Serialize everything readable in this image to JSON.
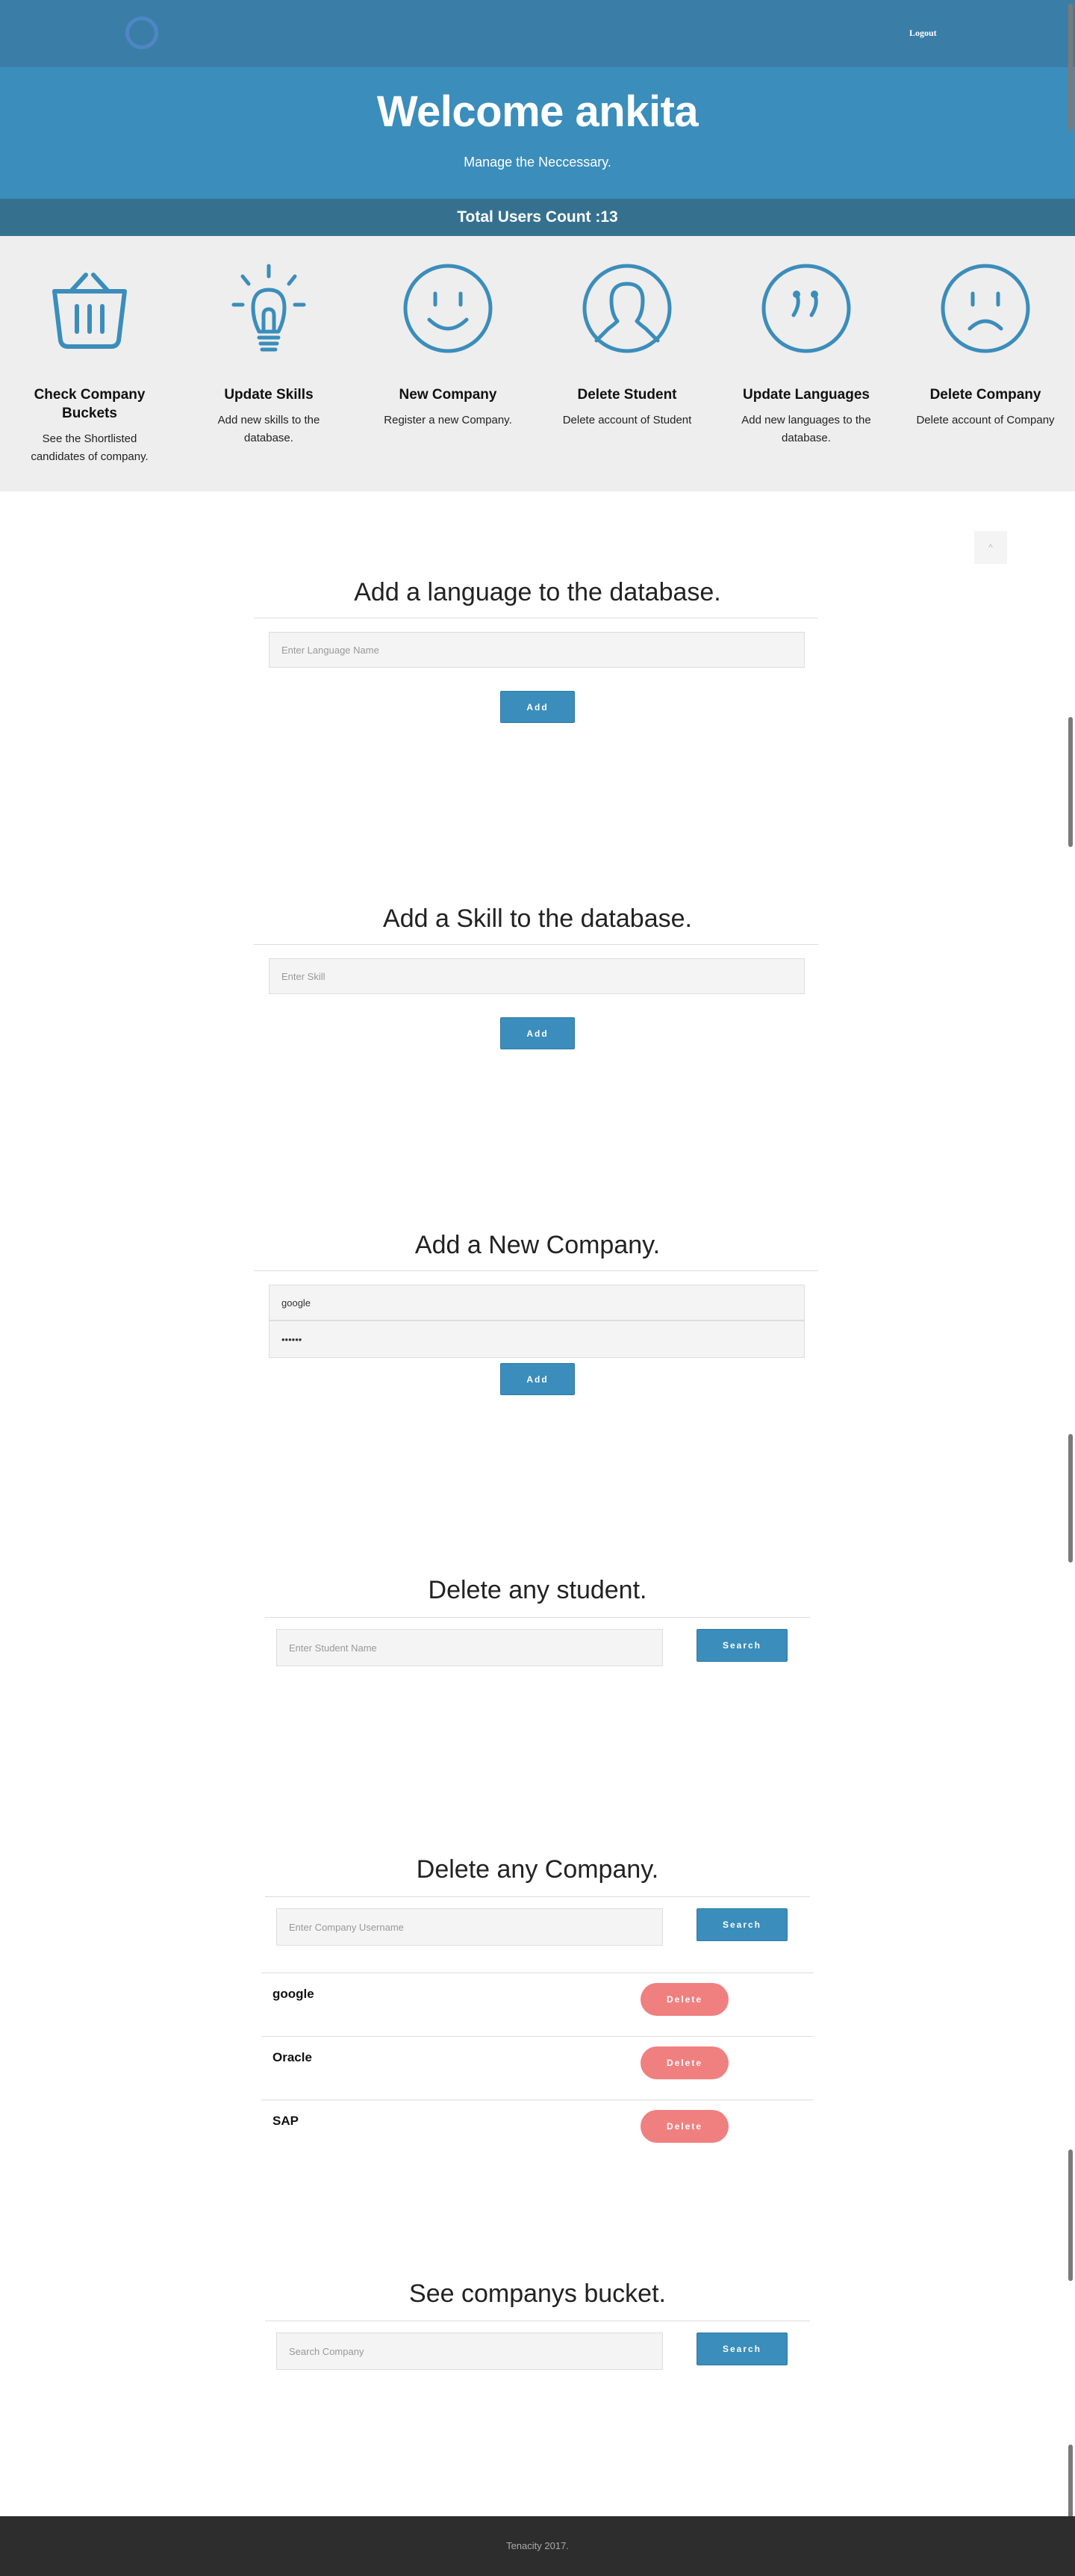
{
  "nav": {
    "logout_label": "Logout"
  },
  "hero": {
    "title": "Welcome ankita",
    "subtitle": "Manage the Neccessary."
  },
  "stats": {
    "total_users": "Total Users Count :13"
  },
  "features": [
    {
      "icon": "basket-icon",
      "title": "Check Company Buckets",
      "desc": "See the Shortlisted candidates of company."
    },
    {
      "icon": "lightbulb-icon",
      "title": "Update Skills",
      "desc": "Add new skills to the database."
    },
    {
      "icon": "smile-icon",
      "title": "New Company",
      "desc": "Register a new Company."
    },
    {
      "icon": "user-icon",
      "title": "Delete Student",
      "desc": "Delete account of Student"
    },
    {
      "icon": "quote-icon",
      "title": "Update Languages",
      "desc": "Add new languages to the database."
    },
    {
      "icon": "sad-face-icon",
      "title": "Delete Company",
      "desc": "Delete account of Company"
    }
  ],
  "back_to_top": "^",
  "language_section": {
    "title": "Add a language to the database.",
    "placeholder": "Enter Language Name",
    "button": "Add"
  },
  "skill_section": {
    "title": "Add a Skill to the database.",
    "placeholder": "Enter Skill",
    "button": "Add"
  },
  "company_section": {
    "title": "Add a New Company.",
    "username_value": "google",
    "password_value": "••••••",
    "button": "Add"
  },
  "delete_student_section": {
    "title": "Delete any student.",
    "placeholder": "Enter Student Name",
    "button": "Search"
  },
  "delete_company_section": {
    "title": "Delete any Company.",
    "placeholder": "Enter Company Username",
    "button": "Search",
    "companies": [
      {
        "name": "google",
        "button": "Delete"
      },
      {
        "name": "Oracle",
        "button": "Delete"
      },
      {
        "name": "SAP",
        "button": "Delete"
      }
    ],
    "delete_color": "#f08080"
  },
  "bucket_section": {
    "title": "See companys bucket.",
    "placeholder": "Search Company",
    "button": "Search"
  },
  "footer": {
    "text": "Tenacity 2017."
  },
  "colors": {
    "primary": "#3b8dbb",
    "topbar": "#3a7ea8",
    "countbar": "#35718f",
    "footer": "#2d2d2d"
  }
}
